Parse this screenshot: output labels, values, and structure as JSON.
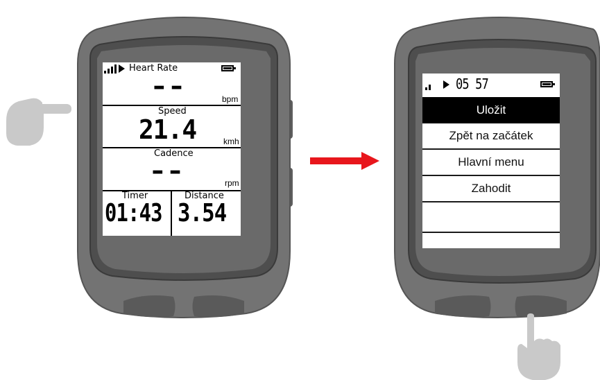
{
  "left_device": {
    "status": {
      "title": "Heart Rate"
    },
    "fields": [
      {
        "label": "",
        "value": "--",
        "unit": "bpm"
      },
      {
        "label": "Speed",
        "value": "21.4",
        "unit": "kmh"
      },
      {
        "label": "Cadence",
        "value": "--",
        "unit": "rpm"
      }
    ],
    "bottom_fields": [
      {
        "label": "Timer",
        "value": "01:43"
      },
      {
        "label": "Distance",
        "value": "3.54"
      }
    ]
  },
  "right_device": {
    "status": {
      "time": "05 57"
    },
    "menu": [
      {
        "label": "Uložit",
        "selected": true
      },
      {
        "label": "Zpět na začátek",
        "selected": false
      },
      {
        "label": "Hlavní menu",
        "selected": false
      },
      {
        "label": "Zahodit",
        "selected": false
      },
      {
        "label": "",
        "selected": false
      }
    ]
  },
  "colors": {
    "device_body": "#707070",
    "device_edge": "#5f5f5f",
    "bezel": "#4a4a4a",
    "arrow": "#e8161c",
    "hand": "#c8c8c8",
    "selected_bg": "#000000"
  }
}
